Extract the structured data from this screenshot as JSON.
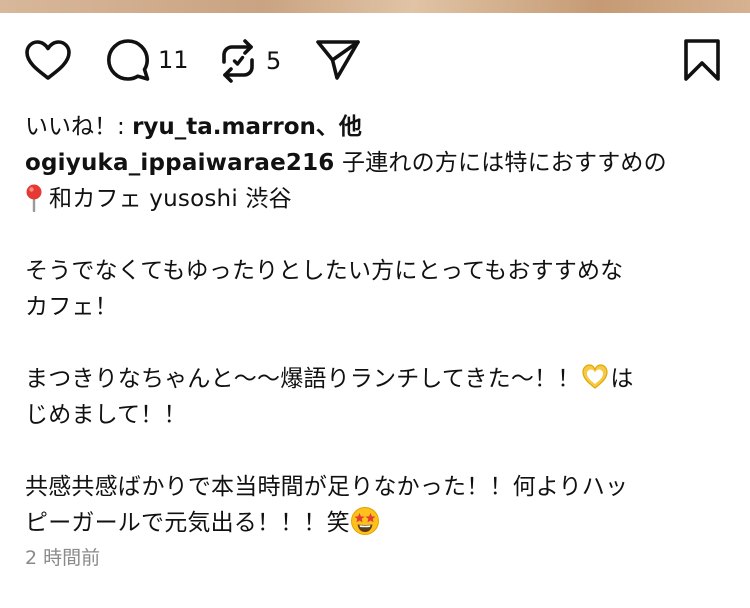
{
  "actions": {
    "comment_count": "11",
    "repost_count": "5"
  },
  "likes": {
    "prefix": "いいね！: ",
    "users": "ryu_ta.marron、他"
  },
  "caption": {
    "username": "ogiyuka_ippaiwarae216",
    "lines": [
      " 子連れの方には特におすすめの",
      "和カフェ yusoshi 渋谷",
      "そうでなくてもゆったりとしたい方にとってもおすすめな",
      "カフェ！",
      "まつきりなちゃんと〜〜爆語りランチしてきた〜！！",
      "は",
      "じめまして！！",
      "共感共感ばかりで本当時間が足りなかった！！何よりハッ",
      "ピーガールで元気出る！！！笑"
    ]
  },
  "timestamp": "2 時間前",
  "icons": {
    "like": "heart-outline-icon",
    "comment": "speech-bubble-icon",
    "repost": "repost-arrows-icon",
    "share": "paper-plane-icon",
    "save": "bookmark-outline-icon",
    "pin": "round-pushpin-emoji",
    "heart_hands": "heart-hands-emoji",
    "star_struck": "star-struck-emoji"
  }
}
